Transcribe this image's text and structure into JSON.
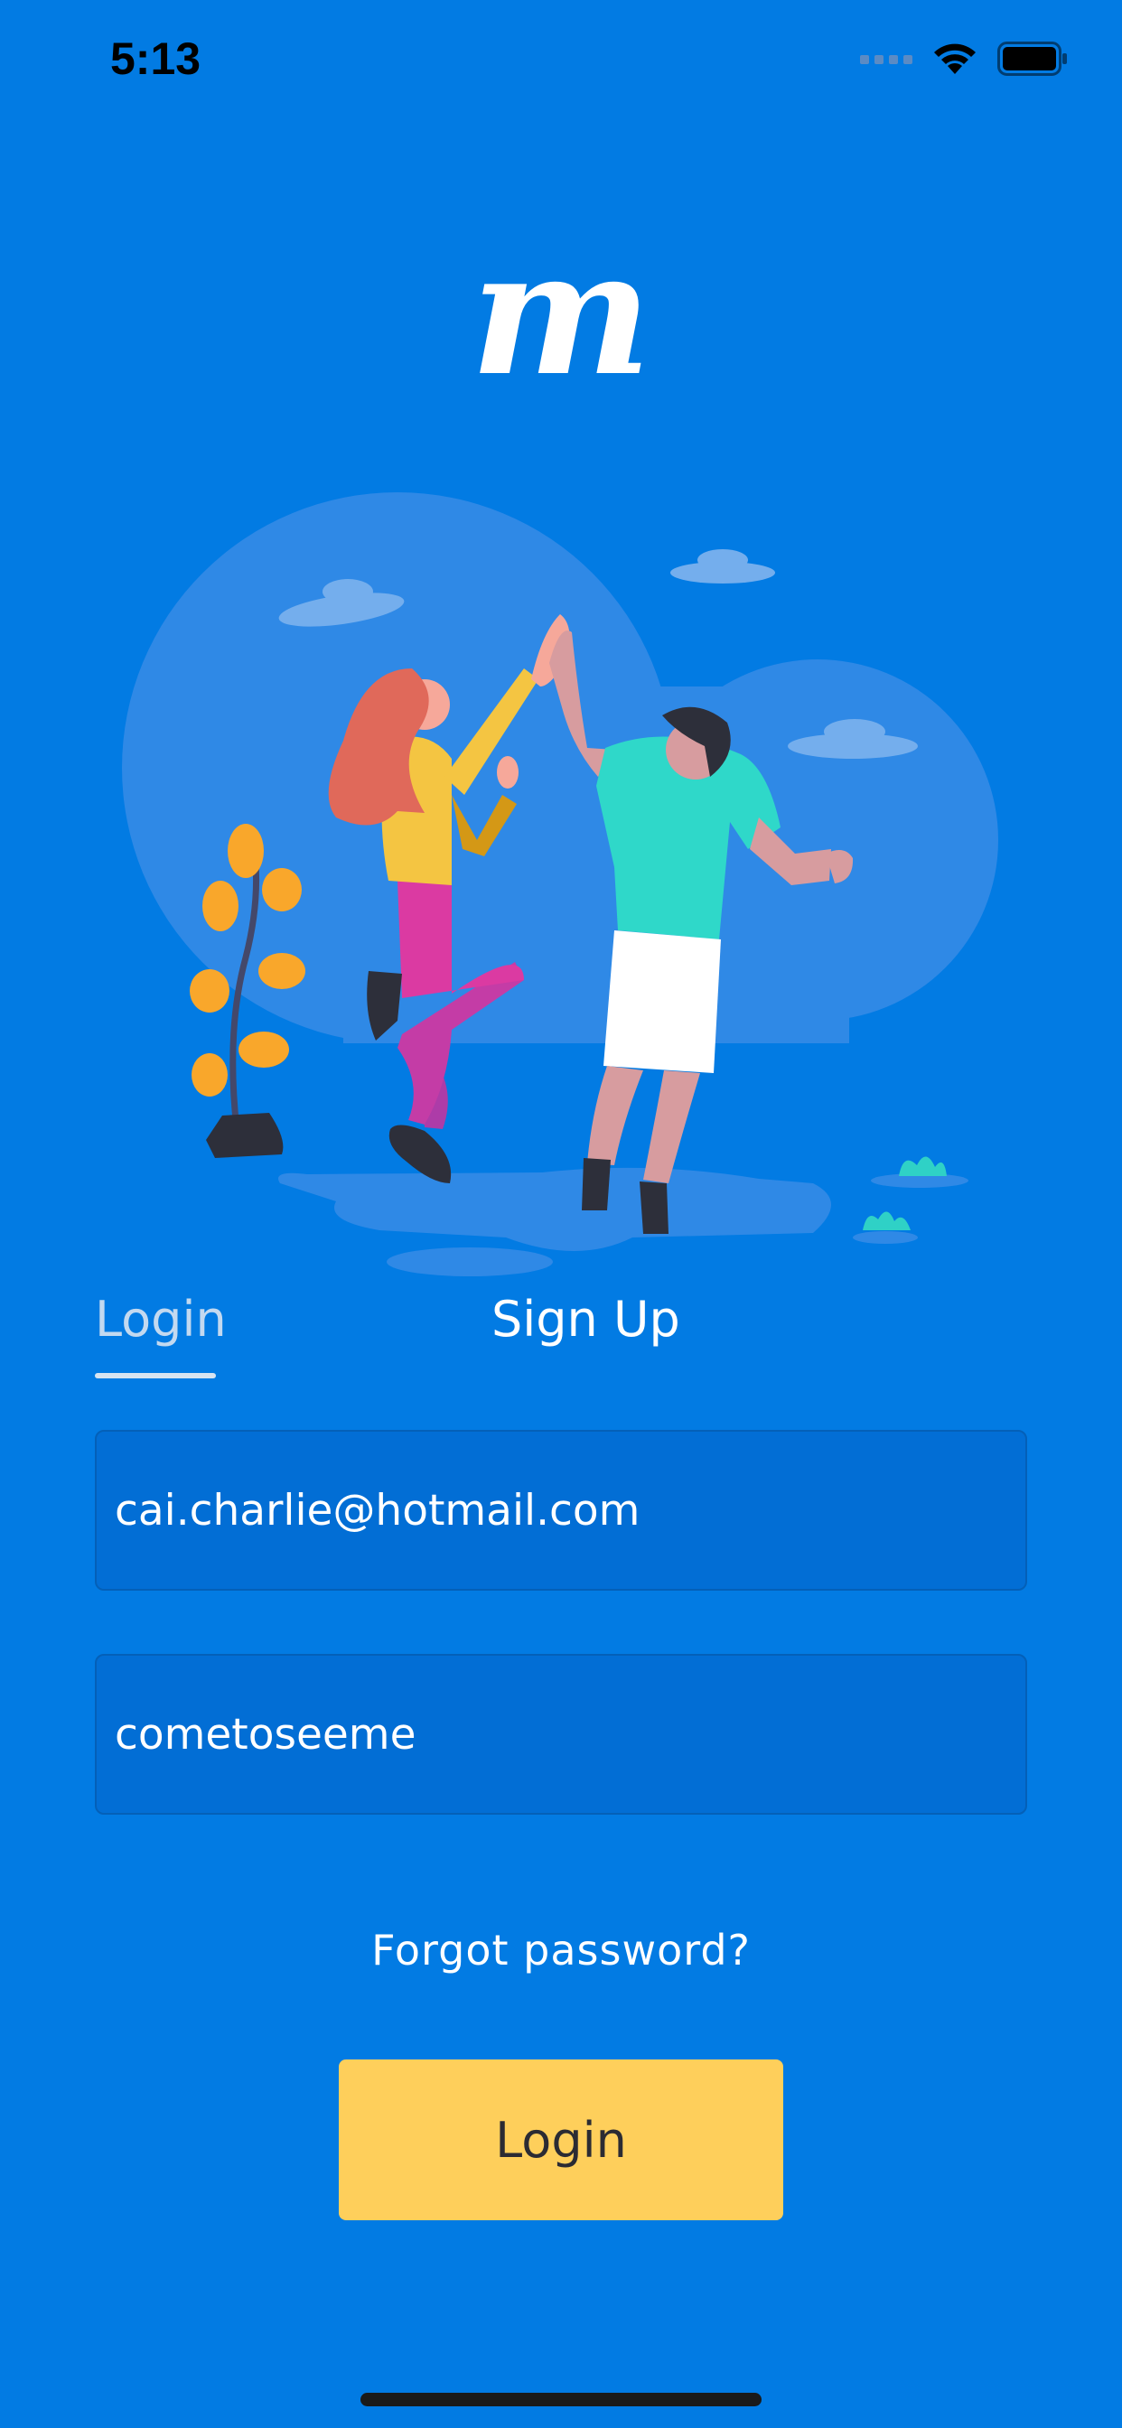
{
  "status_bar": {
    "time": "5:13"
  },
  "brand": {
    "logo_letter": "m"
  },
  "tabs": [
    {
      "label": "Login",
      "active": true
    },
    {
      "label": "Sign Up",
      "active": false
    }
  ],
  "form": {
    "email_value": "cai.charlie@hotmail.com",
    "password_value": "cometoseeme"
  },
  "forgot_password_label": "Forgot password?",
  "login_button_label": "Login",
  "colors": {
    "background": "#027be3",
    "input_background": "#026ed5",
    "button": "#fecf5b",
    "tab_inactive_text": "#c3d9f0"
  }
}
